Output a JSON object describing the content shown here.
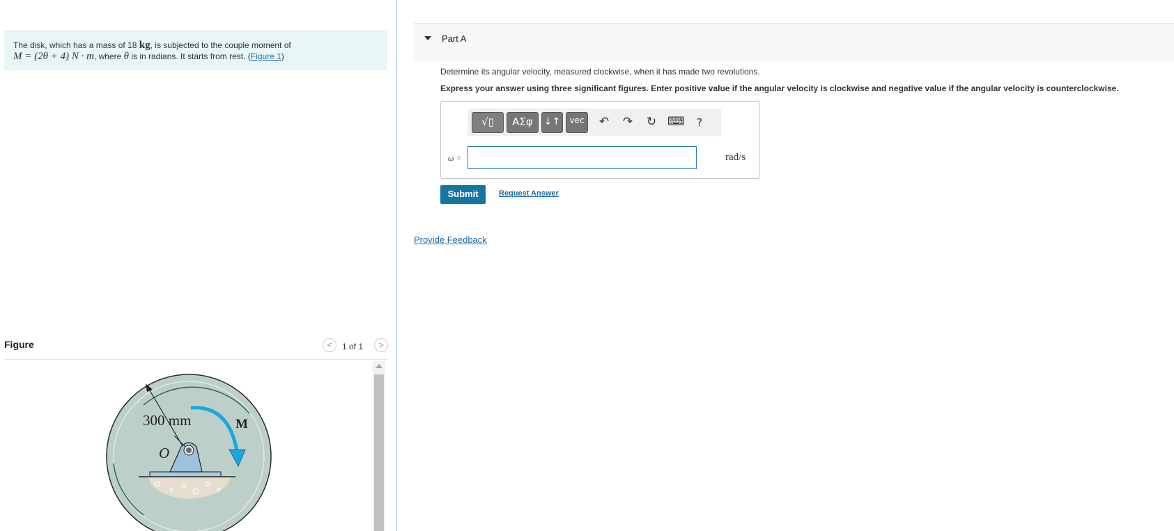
{
  "problem": {
    "text_part1": "The disk, which has a mass of 18",
    "mass_unit": "kg",
    "text_part2": ", is subjected to the couple moment of",
    "moment_expr": "M = (2θ + 4) N · m",
    "text_part3": ", where",
    "theta": "θ",
    "text_part4": "is in radians. It starts from rest. (",
    "figure_link": "Figure 1",
    "text_part5": ")"
  },
  "figure_panel": {
    "title": "Figure",
    "pager_prev": "<",
    "pager_text": "1 of 1",
    "pager_next": ">",
    "labels": {
      "dimension": "300 mm",
      "origin": "O",
      "moment": "M"
    }
  },
  "part": {
    "title": "Part A",
    "question": "Determine its angular velocity, measured clockwise, when it has made two revolutions.",
    "instructions": "Express your answer using three significant figures. Enter positive value if the angular velocity is clockwise and negative value if the angular velocity is counterclockwise."
  },
  "toolbar": {
    "templates_label": "√▯",
    "greek_label": "ΑΣφ",
    "arrows_label": "↓↑",
    "vec_label": "vec",
    "undo_icon": "↶",
    "redo_icon": "↷",
    "reset_icon": "↻",
    "keyboard_icon": "⌨",
    "help_label": "?"
  },
  "answer": {
    "variable_label": "ω =",
    "value": "",
    "units": "rad/s"
  },
  "actions": {
    "submit_label": "Submit",
    "request_label": "Request Answer",
    "feedback_label": "Provide Feedback"
  },
  "colors": {
    "accent": "#1576a0",
    "link": "#1a6aa8",
    "problem_bg": "#e8f6f7",
    "disk": "#bcd0c9",
    "moment_arrow": "#1aa7e0"
  }
}
